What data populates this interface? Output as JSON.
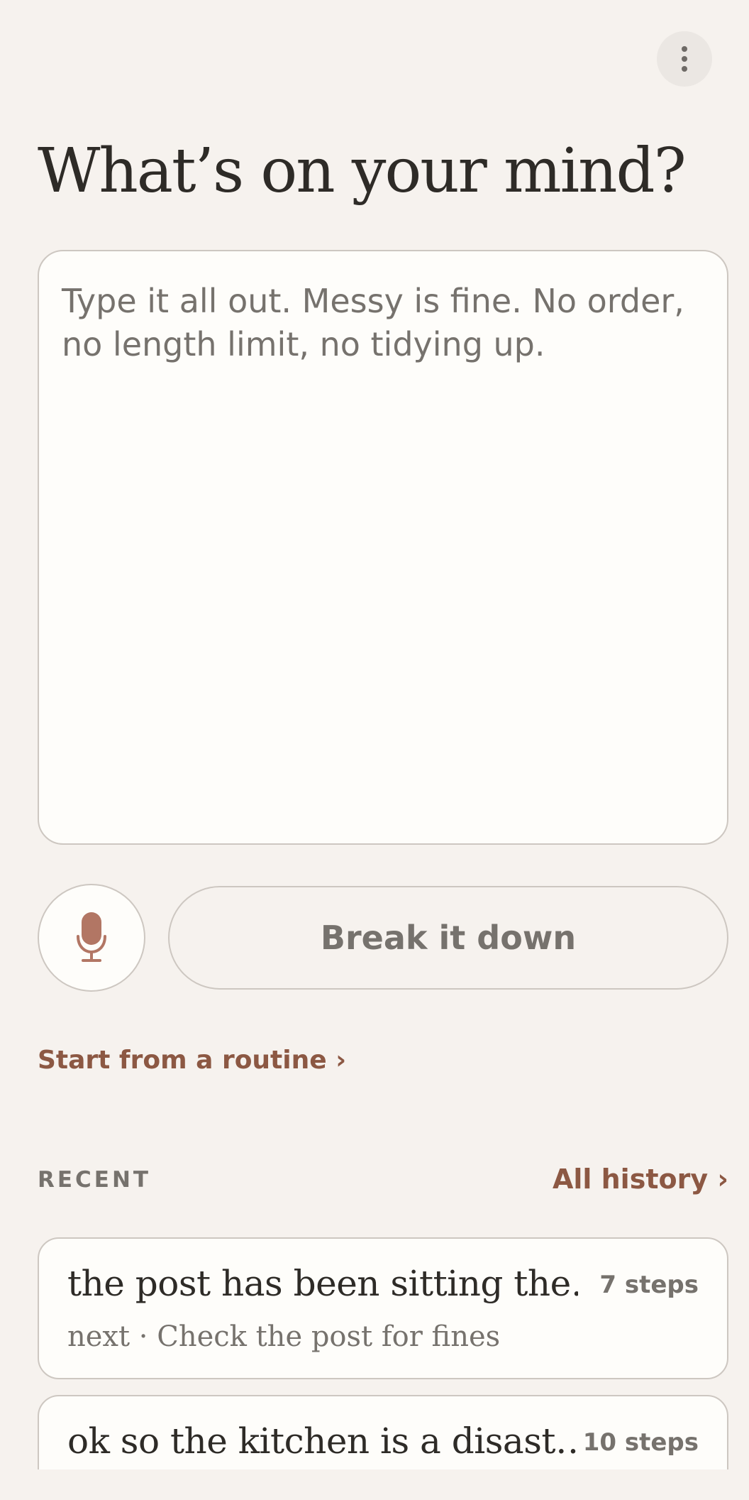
{
  "header": {
    "menu_icon": "more-vertical-icon"
  },
  "page_title": "What’s on your mind?",
  "dump": {
    "placeholder": "Type it all out. Messy is fine. No order, no length limit, no tidying up.",
    "value": ""
  },
  "actions": {
    "mic_icon": "microphone-icon",
    "break_label": "Break it down",
    "routine_link": "Start from a routine ›"
  },
  "recent": {
    "label": "RECENT",
    "all_history_link": "All history ›",
    "items": [
      {
        "title": "the post has been sitting the…",
        "steps": "7 steps",
        "next": "next · Check the post for fines"
      },
      {
        "title": "ok so the kitchen is a disast…",
        "steps": "10 steps",
        "next": ""
      }
    ]
  },
  "colors": {
    "background": "#f6f2ee",
    "surface": "#fefdfa",
    "border": "#cdc7c1",
    "text": "#2e2b27",
    "muted": "#76726d",
    "accent": "#8c5843",
    "mic": "#b27664"
  }
}
